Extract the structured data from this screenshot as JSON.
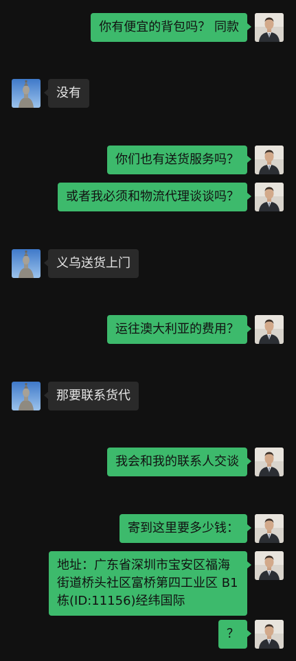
{
  "colors": {
    "background": "#111111",
    "outgoing_bubble": "#3dba6c",
    "incoming_bubble": "#2a2a2a"
  },
  "messages": [
    {
      "direction": "out",
      "text": "你有便宜的背包吗？ 同款",
      "avatar": "man-in-suit-avatar"
    },
    {
      "direction": "in",
      "text": "没有",
      "avatar": "statue-avatar"
    },
    {
      "direction": "out",
      "text": "你们也有送货服务吗？",
      "avatar": "man-in-suit-avatar"
    },
    {
      "direction": "out",
      "text": "或者我必须和物流代理谈谈吗？",
      "avatar": "man-in-suit-avatar"
    },
    {
      "direction": "in",
      "text": "义乌送货上门",
      "avatar": "statue-avatar"
    },
    {
      "direction": "out",
      "text": "运往澳大利亚的费用？",
      "avatar": "man-in-suit-avatar"
    },
    {
      "direction": "in",
      "text": "那要联系货代",
      "avatar": "statue-avatar"
    },
    {
      "direction": "out",
      "text": "我会和我的联系人交谈",
      "avatar": "man-in-suit-avatar"
    },
    {
      "direction": "out",
      "text": "寄到这里要多少钱：",
      "avatar": "man-in-suit-avatar"
    },
    {
      "direction": "out",
      "text": "地址：广东省深圳市宝安区福海街道桥头社区富桥第四工业区 B1 栋(ID:11156)经纬国际",
      "avatar": "man-in-suit-avatar"
    },
    {
      "direction": "out",
      "text": "？",
      "avatar": "man-in-suit-avatar"
    }
  ]
}
